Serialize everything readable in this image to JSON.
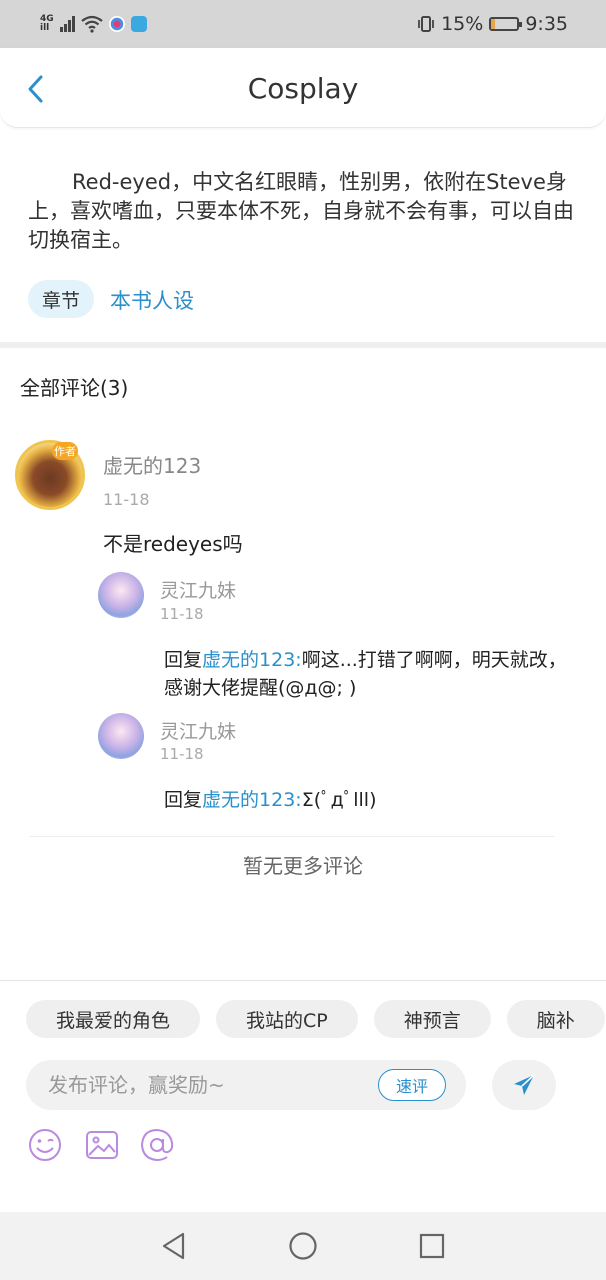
{
  "status_bar": {
    "network_top": "4G",
    "network_bottom": "ill",
    "battery_percent": "15%",
    "battery_level": 0.15,
    "time": "9:35"
  },
  "header": {
    "title": "Cosplay",
    "back_icon": "chevron-left-icon"
  },
  "character": {
    "description": "Red-eyed，中文名红眼睛，性别男，依附在Steve身上，喜欢嗜血，只要本体不死，自身就不会有事，可以自由切换宿主。",
    "chapter_chip": "章节",
    "setting_link": "本书人设"
  },
  "comments": {
    "title": "全部评论(3)",
    "items": [
      {
        "author": "虚无的123",
        "badge": "作者",
        "time": "11-18",
        "text": "不是redeyes吗",
        "replies": [
          {
            "author": "灵江九妹",
            "time": "11-18",
            "prefix": "回复",
            "mention": "虚无的123:",
            "text": "啊这...打错了啊啊，明天就改，感谢大佬提醒(@д@; )"
          },
          {
            "author": "灵江九妹",
            "time": "11-18",
            "prefix": "回复",
            "mention": "虚无的123:",
            "text": "Σ(ﾟдﾟlll)"
          }
        ]
      }
    ],
    "no_more": "暂无更多评论"
  },
  "composer": {
    "quick_tags": [
      "我最爱的角色",
      "我站的CP",
      "神预言",
      "脑补"
    ],
    "placeholder": "发布评论，赢奖励~",
    "quick_review": "速评",
    "send_icon": "send-icon",
    "tools": [
      "emoji-icon",
      "image-icon",
      "mention-icon"
    ]
  },
  "colors": {
    "accent": "#2a8fcc",
    "chip_bg": "#e3f3fb",
    "tool_purple": "#b98be0"
  },
  "nav": [
    "back-triangle-icon",
    "home-circle-icon",
    "recents-square-icon"
  ]
}
